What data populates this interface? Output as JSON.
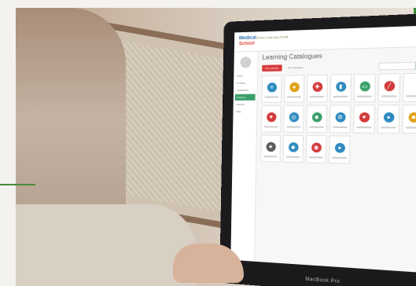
{
  "app": {
    "logo": {
      "a": "Medical",
      "b": "School"
    },
    "site_title": "Online Learning Portal",
    "page_title": "Learning Catalogues",
    "tabs": [
      {
        "label": "My Learning"
      },
      {
        "label": "All Catalogues"
      }
    ],
    "laptop_label": "MacBook Pro"
  },
  "sidebar": {
    "items": [
      {
        "label": "Home",
        "active": false
      },
      {
        "label": "Courses",
        "active": false
      },
      {
        "label": "Catalogues",
        "active": false
      },
      {
        "label": "Learning",
        "active": true
      },
      {
        "label": "Reports",
        "active": false
      },
      {
        "label": "Help",
        "active": false
      }
    ]
  },
  "tiles": [
    {
      "icon": "clipboard-icon",
      "glyph": "≡",
      "color": "#2e8bc0"
    },
    {
      "icon": "person-icon",
      "glyph": "●",
      "color": "#e2a21a"
    },
    {
      "icon": "cross-icon",
      "glyph": "✚",
      "color": "#d43b3b"
    },
    {
      "icon": "bottle-icon",
      "glyph": "▮",
      "color": "#2e8bc0"
    },
    {
      "icon": "laptop-icon",
      "glyph": "▭",
      "color": "#3aa06a"
    },
    {
      "icon": "syringe-icon",
      "glyph": "╱",
      "color": "#d43b3b"
    },
    {
      "icon": "blank-icon",
      "glyph": "",
      "color": "#ffffff"
    },
    {
      "icon": "heart-icon",
      "glyph": "♥",
      "color": "#d43b3b"
    },
    {
      "icon": "stethoscope-icon",
      "glyph": "◎",
      "color": "#2e8bc0"
    },
    {
      "icon": "head-icon",
      "glyph": "☻",
      "color": "#3aa06a"
    },
    {
      "icon": "gear-icon",
      "glyph": "⚙",
      "color": "#2e8bc0"
    },
    {
      "icon": "heart-check-icon",
      "glyph": "♥",
      "color": "#d43b3b"
    },
    {
      "icon": "drop-icon",
      "glyph": "●",
      "color": "#2e8bc0"
    },
    {
      "icon": "box-icon",
      "glyph": "■",
      "color": "#e2a21a"
    },
    {
      "icon": "badge-icon",
      "glyph": "★",
      "color": "#5a5a5a"
    },
    {
      "icon": "people-icon",
      "glyph": "◆",
      "color": "#2e8bc0"
    },
    {
      "icon": "target-icon",
      "glyph": "◉",
      "color": "#d43b3b"
    },
    {
      "icon": "user-icon",
      "glyph": "●",
      "color": "#2e8bc0"
    }
  ]
}
